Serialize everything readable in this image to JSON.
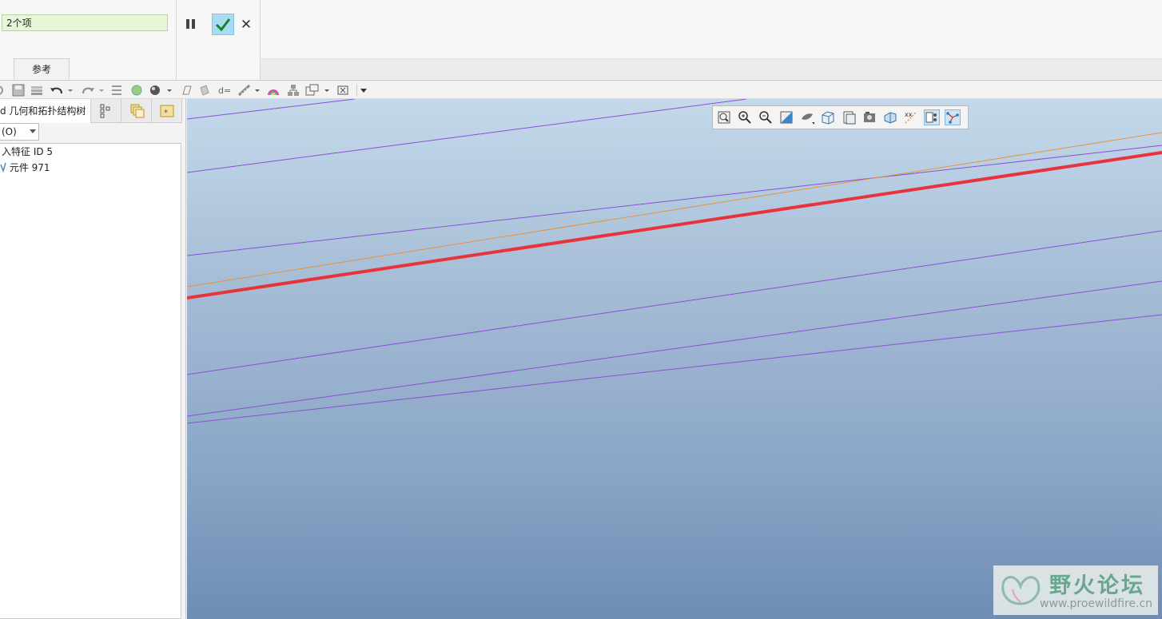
{
  "dashboard": {
    "selection_text": "2个项",
    "tab_reference": "参考",
    "pause_icon": "pause-icon",
    "ok_icon": "checkmark-icon",
    "cancel_icon": "close-icon",
    "cancel_glyph": "✕"
  },
  "quick_access": {
    "icons": [
      "regenerate-icon",
      "save-icon",
      "windows-icon",
      "undo-icon",
      "dropdown-icon",
      "redo-icon",
      "dropdown-icon",
      "regen-manager-icon",
      "appearance-icon",
      "shading-icon",
      "dropdown-icon",
      "plane-icon",
      "surface-icon",
      "dimension-icon",
      "measure-icon",
      "dropdown-icon",
      "render-icon",
      "model-tree-icon",
      "window-icon",
      "dropdown-icon",
      "close-window-icon",
      "customize-icon"
    ]
  },
  "model_tree": {
    "tab_label": "d 几何和拓扑结构树",
    "tab_icons": [
      "tree-settings-icon",
      "layers-icon",
      "folder-icon"
    ],
    "filter_label": "(O)",
    "items": [
      {
        "label": "入特征 ID 5"
      },
      {
        "label": "元件 971"
      }
    ]
  },
  "view_toolbar": {
    "icons": [
      "refit-icon",
      "zoom-in-icon",
      "zoom-out-icon",
      "repaint-icon",
      "display-style-icon",
      "saved-orientations-icon",
      "view-manager-icon",
      "perspective-icon",
      "section-icon",
      "datum-display-icon",
      "spin-center-icon",
      "annotation-display-icon",
      "cable-display-icon"
    ],
    "active": [
      "annotation-display-icon",
      "cable-display-icon"
    ]
  },
  "colors": {
    "highlight_curve": "#e8323c",
    "curve": "#8a4fd6",
    "reference_curve": "#e8923c"
  },
  "watermark": {
    "title": "野火论坛",
    "url": "www.proewildfire.cn"
  }
}
